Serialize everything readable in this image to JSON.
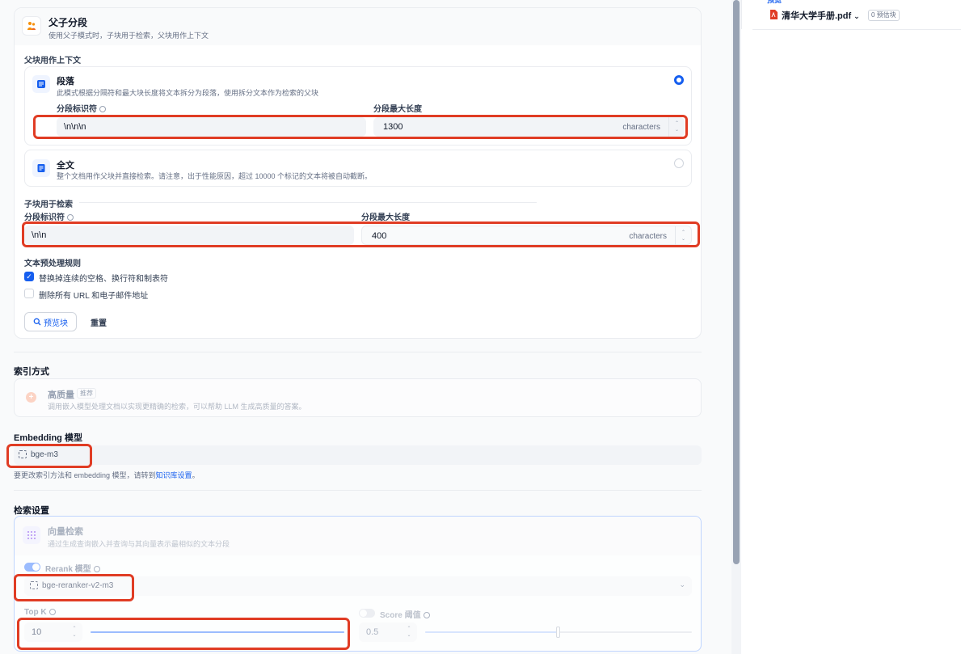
{
  "segment_mode": {
    "title": "父子分段",
    "desc": "使用父子模式时，子块用于检索，父块用作上下文",
    "parent_section": "父块用作上下文",
    "paragraph": {
      "title": "段落",
      "desc": "此模式根据分隔符和最大块长度将文本拆分为段落，使用拆分文本作为检索的父块",
      "separator_label": "分段标识符",
      "separator_value": "\\n\\n\\n",
      "maxlen_label": "分段最大长度",
      "maxlen_value": "1300",
      "unit": "characters"
    },
    "fulltext": {
      "title": "全文",
      "desc": "整个文档用作父块并直接检索。请注意，出于性能原因，超过 10000 个标记的文本将被自动截断。"
    },
    "child_section": "子块用于检索",
    "child": {
      "separator_label": "分段标识符",
      "separator_value": "\\n\\n",
      "maxlen_label": "分段最大长度",
      "maxlen_value": "400",
      "unit": "characters"
    },
    "preprocess_title": "文本预处理规则",
    "rule1": "替换掉连续的空格、换行符和制表符",
    "rule2": "删除所有 URL 和电子邮件地址",
    "preview_btn": "预览块",
    "reset_btn": "重置"
  },
  "index": {
    "title": "索引方式",
    "hq_title": "高质量",
    "hq_badge": "推荐",
    "hq_desc": "调用嵌入模型处理文档以实现更精确的检索，可以帮助 LLM 生成高质量的答案。"
  },
  "embedding": {
    "title": "Embedding 模型",
    "model": "bge-m3",
    "hint_prefix": "要更改索引方法和 embedding 模型，请转到",
    "hint_link": "知识库设置",
    "hint_suffix": "。"
  },
  "retrieval": {
    "title": "检索设置",
    "vector_title": "向量检索",
    "vector_desc": "通过生成查询嵌入并查询与其向量表示最相似的文本分段",
    "rerank_label": "Rerank 模型",
    "rerank_model": "bge-reranker-v2-m3",
    "topk_label": "Top K",
    "topk_value": "10",
    "topk_fraction": 1.0,
    "score_label": "Score 阈值",
    "score_value": "0.5",
    "score_fraction": 0.5
  },
  "preview": {
    "label": "预览",
    "file_name": "清华大学手册.pdf",
    "chunk_badge": "0 预估块"
  },
  "colors": {
    "accent": "#155eef",
    "highlight": "#e03c24"
  }
}
